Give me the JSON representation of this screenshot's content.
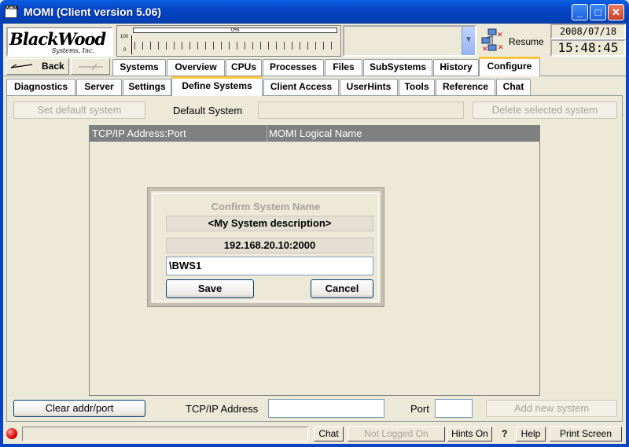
{
  "window": {
    "icon_label": "MOMI",
    "title": "MOMI (Client version 5.06)",
    "minimize": "_",
    "maximize": "□",
    "close": "✕"
  },
  "header": {
    "logo_word": "BlackWood",
    "logo_sub": "Systems, Inc.",
    "meter_percent_label": "0%",
    "meter_max_label": "100",
    "meter_min_label": "0",
    "resume_label": "Resume",
    "date": "2008/07/18",
    "time": "15:48:45"
  },
  "nav": {
    "back_label": "Back",
    "tabs": [
      {
        "label": "Systems"
      },
      {
        "label": "Overview"
      },
      {
        "label": "CPUs"
      },
      {
        "label": "Processes"
      },
      {
        "label": "Files"
      },
      {
        "label": "SubSystems"
      },
      {
        "label": "History"
      },
      {
        "label": "Configure"
      }
    ],
    "active_tab": "Configure"
  },
  "subtabs": {
    "tabs": [
      {
        "label": "Diagnostics"
      },
      {
        "label": "Server"
      },
      {
        "label": "Settings"
      },
      {
        "label": "Define Systems"
      },
      {
        "label": "Client Access"
      },
      {
        "label": "UserHints"
      },
      {
        "label": "Tools"
      },
      {
        "label": "Reference"
      },
      {
        "label": "Chat"
      }
    ],
    "active_tab": "Define Systems"
  },
  "define_systems": {
    "set_default_label": "Set default system",
    "default_system_label": "Default System",
    "default_system_value": "",
    "delete_label": "Delete selected system",
    "table": {
      "columns": [
        "TCP/IP Address:Port",
        "MOMI Logical Name"
      ],
      "rows": []
    },
    "clear_label": "Clear addr/port",
    "tcpip_label": "TCP/IP Address",
    "tcpip_value": "",
    "port_label": "Port",
    "port_value": "",
    "add_label": "Add new system"
  },
  "dialog": {
    "title": "Confirm System Name",
    "description": "<My System description>",
    "address": "192.168.20.10:2000",
    "name_value": "\\BWS1",
    "save_label": "Save",
    "cancel_label": "Cancel"
  },
  "statusbar": {
    "status_text": "",
    "chat_label": "Chat",
    "login_label": "Not Logged On",
    "hints_label": "Hints On",
    "help_q": "?",
    "help_label": "Help",
    "print_label": "Print Screen"
  },
  "colors": {
    "titlebar": "#0845C5",
    "tab_highlight": "#FFC83C",
    "status_led": "#E00000",
    "table_header": "#808080"
  }
}
